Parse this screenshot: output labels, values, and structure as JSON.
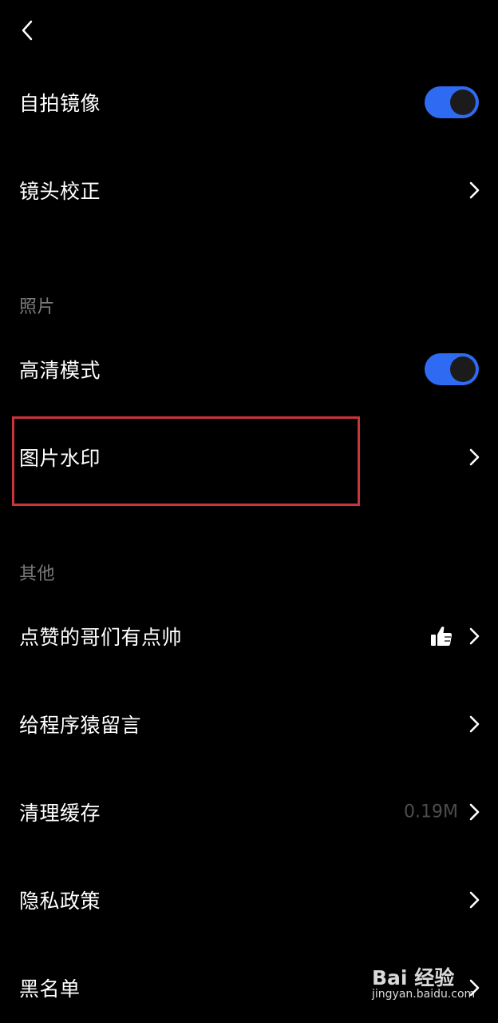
{
  "header": {
    "back_icon": "chevron-left-icon"
  },
  "rows_top": [
    {
      "label": "自拍镜像",
      "control": "toggle",
      "on": true
    },
    {
      "label": "镜头校正",
      "control": "chevron"
    }
  ],
  "sections": {
    "photo": {
      "title": "照片",
      "items": [
        {
          "label": "高清模式",
          "control": "toggle",
          "on": true
        },
        {
          "label": "图片水印",
          "control": "chevron"
        }
      ]
    },
    "other": {
      "title": "其他",
      "items": [
        {
          "label": "点赞的哥们有点帅",
          "control": "chevron",
          "icon": "thumbs-up-icon"
        },
        {
          "label": "给程序猿留言",
          "control": "chevron"
        },
        {
          "label": "清理缓存",
          "control": "chevron",
          "value": "0.19M"
        },
        {
          "label": "隐私政策",
          "control": "chevron"
        },
        {
          "label": "黑名单",
          "control": "chevron"
        }
      ]
    }
  },
  "watermark": {
    "logo_text": "Bai 经验",
    "url": "jingyan.baidu.com"
  },
  "colors": {
    "background": "#000000",
    "toggle_on": "#2f6bf2",
    "section_title": "#7a7a7a",
    "highlight_border": "#c8333c",
    "value_text": "#4d4d4d"
  }
}
